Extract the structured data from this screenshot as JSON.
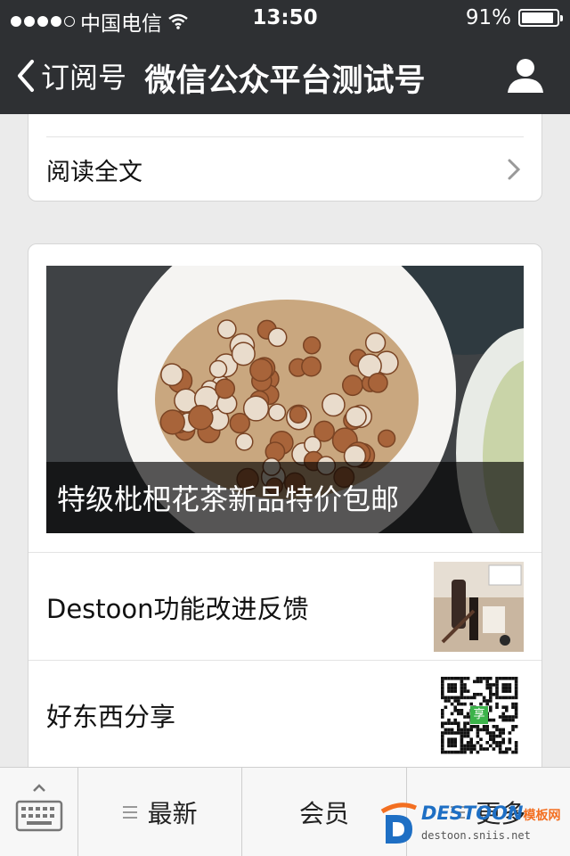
{
  "status_bar": {
    "carrier": "中国电信",
    "time": "13:50",
    "battery_percent_text": "91%",
    "battery_level": 0.91,
    "signal_bars": 4
  },
  "nav": {
    "back_label": "订阅号",
    "title": "微信公众平台测试号",
    "profile_icon": "person-icon"
  },
  "previous_card": {
    "read_full_label": "阅读全文"
  },
  "news_card": {
    "cover_caption": "特级枇杷花茶新品特价包邮",
    "articles": [
      {
        "title": "Destoon功能改进反馈"
      },
      {
        "title": "好东西分享",
        "thumb_badge": "享"
      }
    ]
  },
  "tab_bar": {
    "keyboard_icon": "keyboard-icon",
    "tabs": [
      {
        "label": "最新"
      },
      {
        "label": "会员"
      },
      {
        "label": "更多"
      }
    ]
  },
  "watermark": {
    "brand": "DESTOON",
    "brand_cn": "模板网",
    "url": "destoon.sniis.net"
  },
  "colors": {
    "header_bg": "#2e3033",
    "page_bg": "#ebebeb",
    "watermark_blue": "#1e6fc4",
    "watermark_orange": "#f36f21"
  }
}
